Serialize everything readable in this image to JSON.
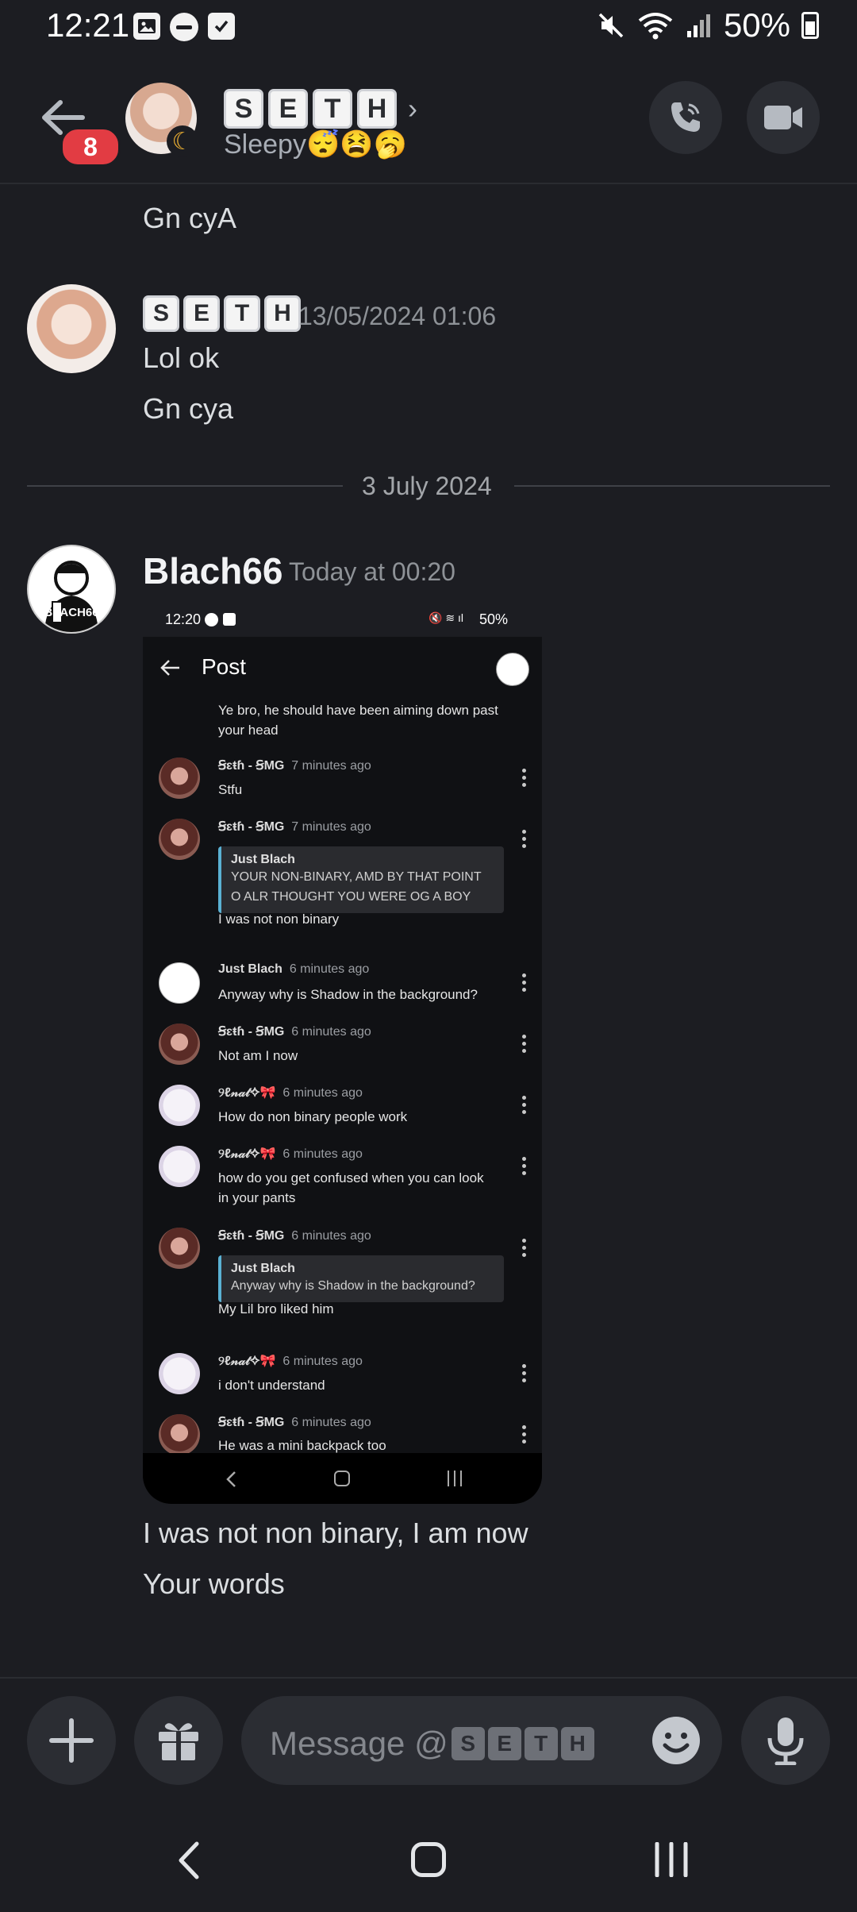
{
  "status_bar": {
    "time": "12:21",
    "battery": "50%"
  },
  "header": {
    "unread_badge": "8",
    "name_letters": [
      "S",
      "E",
      "T",
      "H"
    ],
    "status": "Sleepy😴😫🥱"
  },
  "messages": {
    "prev_tail": "Gn cyA",
    "seth_msg": {
      "name_letters": [
        "S",
        "E",
        "T",
        "H"
      ],
      "timestamp": "13/05/2024 01:06",
      "lines": [
        "Lol ok",
        "Gn cya"
      ]
    },
    "date_divider": "3 July 2024",
    "blach_msg": {
      "username": "Blach66",
      "timestamp": "Today at 00:20",
      "avatar_text": "BLACH66",
      "lines": [
        "I was not non binary, I am now",
        "Your words"
      ]
    }
  },
  "screenshot": {
    "status_time": "12:20",
    "status_battery": "50%",
    "title": "Post",
    "top_text": "Ye bro, he should have been aiming down past your head",
    "comments": [
      {
        "name": "Ꞩɛŧɦ - ꞨMG",
        "time": "7 minutes ago",
        "text": "Stfu"
      },
      {
        "name": "Ꞩɛŧɦ - ꞨMG",
        "time": "7 minutes ago",
        "quote_name": "Just Blach",
        "quote_text": "YOUR NON-BINARY, AMD BY THAT POINT O ALR THOUGHT YOU WERE OG A BOY",
        "text": "I was not non binary"
      },
      {
        "name": "Just Blach",
        "time": "6 minutes ago",
        "text": "Anyway why is Shadow in the background?"
      },
      {
        "name": "Ꞩɛŧɦ - ꞨMG",
        "time": "6 minutes ago",
        "text": "Not am I now"
      },
      {
        "name": "୨ℓ𝓃𝒶𝓉✧🎀",
        "time": "6 minutes ago",
        "text": "How do non binary people work"
      },
      {
        "name": "୨ℓ𝓃𝒶𝓉✧🎀",
        "time": "6 minutes ago",
        "text": "how do you get confused when you can look in your pants"
      },
      {
        "name": "Ꞩɛŧɦ - ꞨMG",
        "time": "6 minutes ago",
        "quote_name": "Just Blach",
        "quote_text": "Anyway why is Shadow in the background?",
        "text": "My Lil bro liked him"
      },
      {
        "name": "୨ℓ𝓃𝒶𝓉✧🎀",
        "time": "6 minutes ago",
        "text": "i don't understand"
      },
      {
        "name": "Ꞩɛŧɦ - ꞨMG",
        "time": "6 minutes ago",
        "text": "He was a mini backpack too"
      }
    ]
  },
  "composer": {
    "placeholder_prefix": "Message @",
    "name_letters": [
      "S",
      "E",
      "T",
      "H"
    ]
  },
  "colors": {
    "background": "#1c1d22",
    "badge": "#e23c43",
    "quote_bar": "#5ab1d3"
  },
  "icons": [
    "back-arrow-icon",
    "phone-icon",
    "video-icon",
    "plus-icon",
    "gift-icon",
    "emoji-icon",
    "mic-icon"
  ]
}
